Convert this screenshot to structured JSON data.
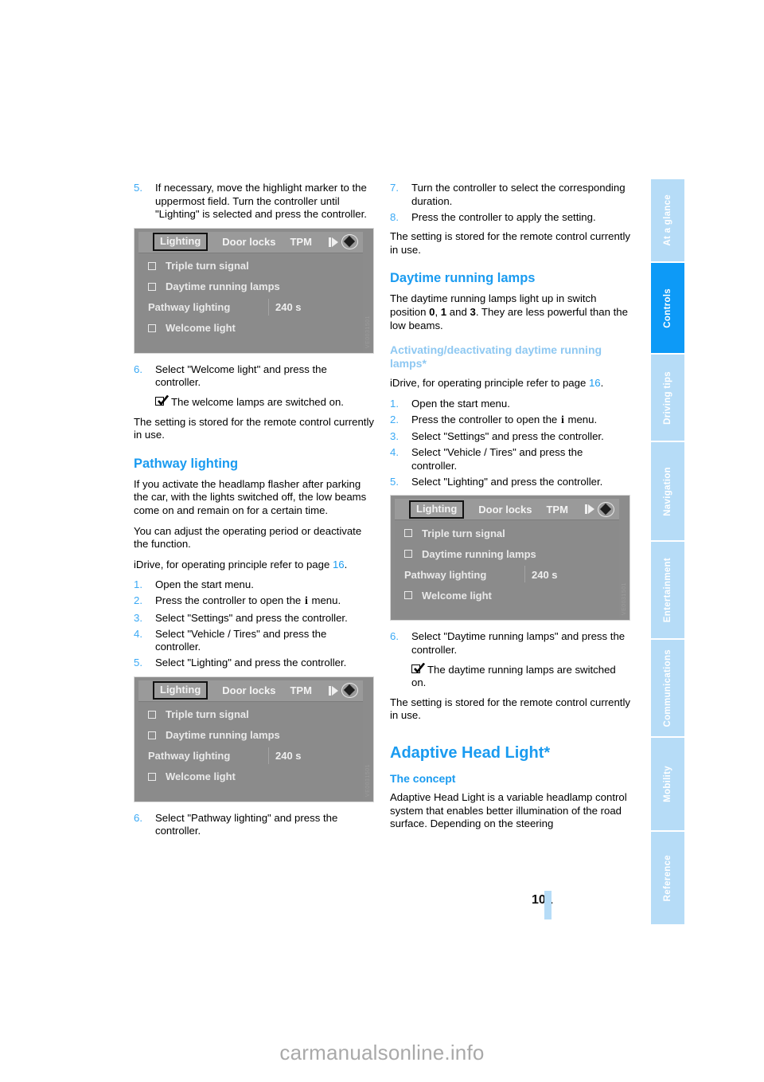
{
  "document": {
    "page_number": "101",
    "watermark": "carmanualsonline.info"
  },
  "sidenav": {
    "tabs": [
      {
        "label": "At a glance",
        "active": false
      },
      {
        "label": "Controls",
        "active": true
      },
      {
        "label": "Driving tips",
        "active": false
      },
      {
        "label": "Navigation",
        "active": false
      },
      {
        "label": "Entertainment",
        "active": false
      },
      {
        "label": "Communications",
        "active": false
      },
      {
        "label": "Mobility",
        "active": false
      },
      {
        "label": "Reference",
        "active": false
      }
    ],
    "active_color": "#0d9af7",
    "inactive_color": "#b6dcf7"
  },
  "colors": {
    "heading_blue": "#1a9bf0",
    "subheading_light_blue": "#8ec8f2",
    "step_number_blue": "#3aa9f5",
    "idrive_background": "#8c8c8c"
  },
  "idrive_screen": {
    "tabs": [
      {
        "label": "Lighting",
        "selected": true
      },
      {
        "label": "Door locks",
        "selected": false
      },
      {
        "label": "TPM",
        "selected": false
      }
    ],
    "icons": [
      "right-arrow-icon",
      "diamond-icon"
    ],
    "rows": [
      {
        "type": "checkbox",
        "label": "Triple turn signal",
        "value": ""
      },
      {
        "type": "checkbox",
        "label": "Daytime running lamps",
        "value": ""
      },
      {
        "type": "value",
        "label": "Pathway lighting",
        "value": "240 s"
      },
      {
        "type": "checkbox",
        "label": "Welcome light",
        "value": ""
      }
    ],
    "figure_code": "VE0031501"
  },
  "left_column": {
    "step5": {
      "num": "5.",
      "text": "If necessary, move the highlight marker to the uppermost field. Turn the controller until \"Lighting\" is selected and press the controller."
    },
    "step6": {
      "num": "6.",
      "text": "Select \"Welcome light\" and press the controller."
    },
    "result6": "The welcome lamps are switched on.",
    "stored_note": "The setting is stored for the remote control currently in use.",
    "pathway_heading": "Pathway lighting",
    "pathway_p1": "If you activate the headlamp flasher after parking the car, with the lights switched off, the low beams come on and remain on for a certain time.",
    "pathway_p2": "You can adjust the operating period or deactivate the function.",
    "idrive_ref_pre": "iDrive, for operating principle refer to page ",
    "idrive_ref_page": "16",
    "idrive_ref_post": ".",
    "steps": [
      {
        "num": "1.",
        "text": "Open the start menu."
      },
      {
        "num": "2.",
        "text_pre": "Press the controller to open the ",
        "glyph": "i",
        "text_post": " menu."
      },
      {
        "num": "3.",
        "text": "Select \"Settings\" and press the controller."
      },
      {
        "num": "4.",
        "text": "Select \"Vehicle / Tires\" and press the controller."
      },
      {
        "num": "5.",
        "text": "Select \"Lighting\" and press the controller."
      }
    ],
    "final_step": {
      "num": "6.",
      "text": "Select \"Pathway lighting\" and press the controller."
    }
  },
  "right_column": {
    "step7": {
      "num": "7.",
      "text": "Turn the controller to select the corresponding duration."
    },
    "step8": {
      "num": "8.",
      "text": "Press the controller to apply the setting."
    },
    "stored_note_top": "The setting is stored for the remote control currently in use.",
    "drl_heading": "Daytime running lamps",
    "drl_p_pre": "The daytime running lamps light up in switch position ",
    "drl_pos_0": "0",
    "drl_p_mid1": ", ",
    "drl_pos_1": "1",
    "drl_p_mid2": " and ",
    "drl_pos_3": "3",
    "drl_p_post": ". They are less powerful than the low beams.",
    "activating_heading": "Activating/deactivating daytime running lamps*",
    "idrive_ref_pre": "iDrive, for operating principle refer to page ",
    "idrive_ref_page": "16",
    "idrive_ref_post": ".",
    "steps": [
      {
        "num": "1.",
        "text": "Open the start menu."
      },
      {
        "num": "2.",
        "text_pre": "Press the controller to open the ",
        "glyph": "i",
        "text_post": " menu."
      },
      {
        "num": "3.",
        "text": "Select \"Settings\" and press the controller."
      },
      {
        "num": "4.",
        "text": "Select \"Vehicle / Tires\" and press the controller."
      },
      {
        "num": "5.",
        "text": "Select \"Lighting\" and press the controller."
      }
    ],
    "step6": {
      "num": "6.",
      "text": "Select \"Daytime running lamps\" and press the controller."
    },
    "result6": "The daytime running lamps are switched on.",
    "stored_note_bottom": "The setting is stored for the remote control currently in use.",
    "ahl_heading": "Adaptive Head Light*",
    "concept_heading": "The concept",
    "concept_p": "Adaptive Head Light is a variable headlamp control system that enables better illumination of the road surface. Depending on the steering"
  }
}
